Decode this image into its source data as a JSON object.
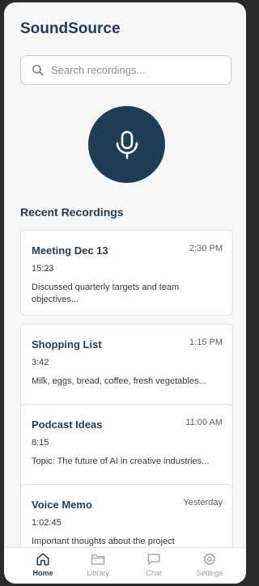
{
  "app": {
    "title": "SoundSource"
  },
  "search": {
    "placeholder": "Search recordings..."
  },
  "record": {
    "icon": "microphone-icon",
    "color": "#1f3d57"
  },
  "recent": {
    "heading": "Recent Recordings",
    "items": [
      {
        "title": "Meeting Dec 13",
        "time": "2:30 PM",
        "duration": "15:23",
        "description": "Discussed quarterly targets and team objectives..."
      },
      {
        "title": "Shopping List",
        "time": "1:15 PM",
        "duration": "3:42",
        "description": "Milk, eggs, bread, coffee, fresh vegetables..."
      },
      {
        "title": "Podcast Ideas",
        "time": "11:00 AM",
        "duration": "8:15",
        "description": "Topic: The future of AI in creative industries..."
      },
      {
        "title": "Voice Memo",
        "time": "Yesterday",
        "duration": "1:02:45",
        "description": "Important thoughts about the project timeline..."
      }
    ]
  },
  "nav": {
    "items": [
      {
        "label": "Home",
        "icon": "home-icon",
        "active": true
      },
      {
        "label": "Library",
        "icon": "folder-icon",
        "active": false
      },
      {
        "label": "Chat",
        "icon": "chat-icon",
        "active": false
      },
      {
        "label": "Settings",
        "icon": "gear-icon",
        "active": false
      }
    ]
  },
  "colors": {
    "primary": "#1f3d57",
    "background": "#f6f6f6",
    "inactive": "#9aa1a8"
  }
}
